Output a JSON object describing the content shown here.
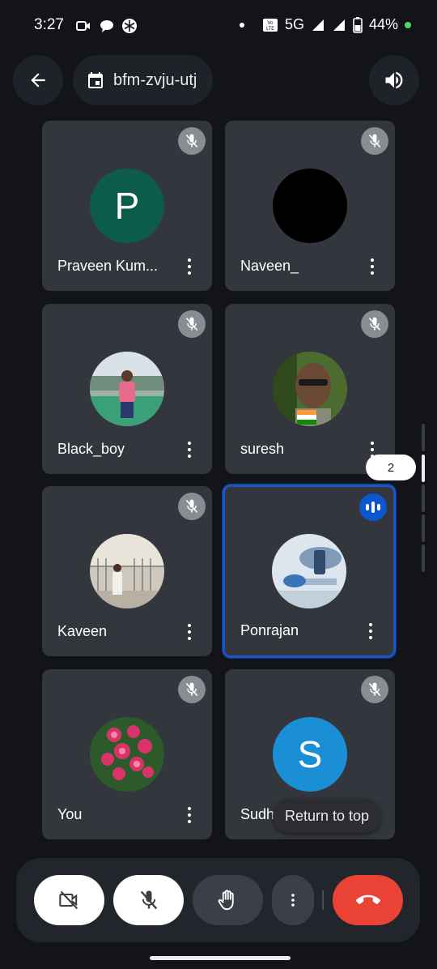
{
  "status_bar": {
    "time": "3:27",
    "network": "5G",
    "battery": "44%",
    "icons": [
      "video-icon",
      "chat-bubble-icon",
      "snowflake-icon",
      "volte-icon",
      "signal-icon",
      "battery-icon"
    ]
  },
  "header": {
    "meeting_code": "bfm-zvju-utj",
    "icons": [
      "back-arrow-icon",
      "calendar-icon",
      "speaker-icon"
    ]
  },
  "participants": [
    {
      "name": "Praveen Kum...",
      "avatar_type": "initial",
      "initial": "P",
      "avatar_color": "#0b5c4a",
      "muted": true
    },
    {
      "name": "Naveen_",
      "avatar_type": "image",
      "avatar_color": "#000000",
      "muted": true
    },
    {
      "name": "Black_boy",
      "avatar_type": "image",
      "muted": true
    },
    {
      "name": "suresh",
      "avatar_type": "image",
      "muted": true
    },
    {
      "name": "Kaveen",
      "avatar_type": "image",
      "muted": true
    },
    {
      "name": "Ponrajan",
      "avatar_type": "image",
      "muted": false,
      "speaking": true
    },
    {
      "name": "You",
      "avatar_type": "image",
      "muted": true
    },
    {
      "name": "Sudhi",
      "avatar_type": "initial",
      "initial": "S",
      "avatar_color": "#1a8fd6",
      "muted": true
    }
  ],
  "pagination": {
    "current_page": "2"
  },
  "return_to_top_label": "Return to top",
  "controls": {
    "icons": [
      "camera-off-icon",
      "mic-off-icon",
      "raise-hand-icon",
      "more-vert-icon",
      "end-call-icon"
    ]
  },
  "colors": {
    "background": "#121419",
    "tile": "#34363e",
    "active_border": "#1a56c4",
    "end_call": "#ea4335"
  }
}
